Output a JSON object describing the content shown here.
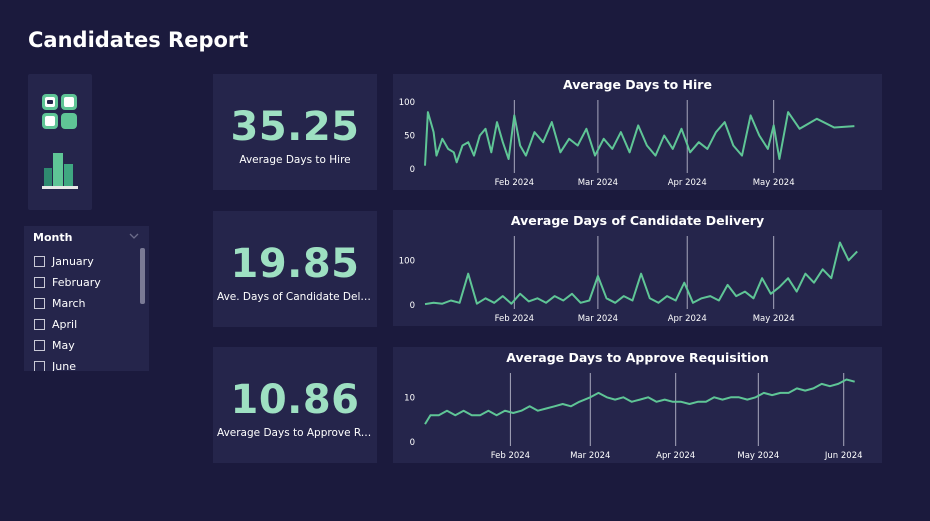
{
  "page": {
    "title": "Candidates Report"
  },
  "nav": {
    "icons": [
      "grid-icon",
      "bar-chart-icon"
    ]
  },
  "slicer": {
    "header": "Month",
    "items": [
      "January",
      "February",
      "March",
      "April",
      "May",
      "June"
    ]
  },
  "cards": [
    {
      "value": "35.25",
      "label": "Average Days to Hire"
    },
    {
      "value": "19.85",
      "label": "Ave. Days of Candidate Delivery"
    },
    {
      "value": "10.86",
      "label": "Average Days to Approve Requisition"
    }
  ],
  "colors": {
    "background": "#1b1a3d",
    "panel": "#25254b",
    "accent": "#5fc596",
    "kpi_text": "#9ee0c2"
  },
  "chart_data": [
    {
      "type": "line",
      "title": "Average Days to Hire",
      "x_range": [
        "2024-01-01",
        "2024-06-01"
      ],
      "ylim": [
        0,
        100
      ],
      "yticks": [
        0,
        50,
        100
      ],
      "xticks": [
        "Feb 2024",
        "Mar 2024",
        "Apr 2024",
        "May 2024"
      ],
      "x": [
        "2024-01-01",
        "2024-01-02",
        "2024-01-04",
        "2024-01-05",
        "2024-01-07",
        "2024-01-09",
        "2024-01-11",
        "2024-01-12",
        "2024-01-14",
        "2024-01-16",
        "2024-01-18",
        "2024-01-20",
        "2024-01-22",
        "2024-01-24",
        "2024-01-26",
        "2024-01-28",
        "2024-01-30",
        "2024-02-01",
        "2024-02-03",
        "2024-02-05",
        "2024-02-08",
        "2024-02-11",
        "2024-02-14",
        "2024-02-17",
        "2024-02-20",
        "2024-02-23",
        "2024-02-26",
        "2024-02-29",
        "2024-03-03",
        "2024-03-06",
        "2024-03-09",
        "2024-03-12",
        "2024-03-15",
        "2024-03-18",
        "2024-03-21",
        "2024-03-24",
        "2024-03-27",
        "2024-03-30",
        "2024-04-02",
        "2024-04-05",
        "2024-04-08",
        "2024-04-11",
        "2024-04-14",
        "2024-04-17",
        "2024-04-20",
        "2024-04-23",
        "2024-04-26",
        "2024-04-29",
        "2024-05-01",
        "2024-05-03",
        "2024-05-06",
        "2024-05-10",
        "2024-05-16",
        "2024-05-22",
        "2024-05-29"
      ],
      "series": [
        {
          "values": [
            5,
            85,
            55,
            20,
            45,
            30,
            25,
            10,
            35,
            40,
            20,
            50,
            60,
            25,
            70,
            40,
            15,
            80,
            35,
            20,
            55,
            40,
            70,
            25,
            45,
            35,
            60,
            20,
            45,
            30,
            55,
            25,
            65,
            35,
            20,
            50,
            30,
            60,
            25,
            40,
            30,
            55,
            70,
            35,
            20,
            80,
            50,
            30,
            65,
            15,
            85,
            60,
            75,
            62,
            64
          ]
        }
      ]
    },
    {
      "type": "line",
      "title": "Average Days of Candidate Delivery",
      "x_range": [
        "2024-01-01",
        "2024-06-01"
      ],
      "ylim": [
        0,
        150
      ],
      "yticks": [
        0,
        100
      ],
      "xticks": [
        "Feb 2024",
        "Mar 2024",
        "Apr 2024",
        "May 2024"
      ],
      "x": [
        "2024-01-01",
        "2024-01-04",
        "2024-01-07",
        "2024-01-10",
        "2024-01-13",
        "2024-01-16",
        "2024-01-19",
        "2024-01-22",
        "2024-01-25",
        "2024-01-28",
        "2024-01-31",
        "2024-02-03",
        "2024-02-06",
        "2024-02-09",
        "2024-02-12",
        "2024-02-15",
        "2024-02-18",
        "2024-02-21",
        "2024-02-24",
        "2024-02-27",
        "2024-03-01",
        "2024-03-04",
        "2024-03-07",
        "2024-03-10",
        "2024-03-13",
        "2024-03-16",
        "2024-03-19",
        "2024-03-22",
        "2024-03-25",
        "2024-03-28",
        "2024-03-31",
        "2024-04-03",
        "2024-04-06",
        "2024-04-09",
        "2024-04-12",
        "2024-04-15",
        "2024-04-18",
        "2024-04-21",
        "2024-04-24",
        "2024-04-27",
        "2024-04-30",
        "2024-05-03",
        "2024-05-06",
        "2024-05-09",
        "2024-05-12",
        "2024-05-15",
        "2024-05-18",
        "2024-05-21",
        "2024-05-24",
        "2024-05-27",
        "2024-05-30"
      ],
      "series": [
        {
          "values": [
            2,
            5,
            3,
            10,
            5,
            70,
            3,
            15,
            5,
            20,
            3,
            25,
            8,
            15,
            5,
            20,
            10,
            25,
            5,
            10,
            65,
            15,
            5,
            20,
            10,
            70,
            15,
            5,
            20,
            10,
            50,
            5,
            15,
            20,
            10,
            45,
            20,
            30,
            15,
            60,
            25,
            40,
            60,
            30,
            70,
            50,
            80,
            60,
            140,
            100,
            120
          ]
        }
      ]
    },
    {
      "type": "line",
      "title": "Average Days to Approve Requisition",
      "x_range": [
        "2024-01-01",
        "2024-06-08"
      ],
      "ylim": [
        0,
        15
      ],
      "yticks": [
        0,
        10
      ],
      "xticks": [
        "Feb 2024",
        "Mar 2024",
        "Apr 2024",
        "May 2024",
        "Jun 2024"
      ],
      "x": [
        "2024-01-01",
        "2024-01-03",
        "2024-01-06",
        "2024-01-09",
        "2024-01-12",
        "2024-01-15",
        "2024-01-18",
        "2024-01-21",
        "2024-01-24",
        "2024-01-27",
        "2024-01-30",
        "2024-02-02",
        "2024-02-05",
        "2024-02-08",
        "2024-02-11",
        "2024-02-14",
        "2024-02-17",
        "2024-02-20",
        "2024-02-23",
        "2024-02-26",
        "2024-03-01",
        "2024-03-04",
        "2024-03-07",
        "2024-03-10",
        "2024-03-13",
        "2024-03-16",
        "2024-03-19",
        "2024-03-22",
        "2024-03-25",
        "2024-03-28",
        "2024-03-31",
        "2024-04-03",
        "2024-04-06",
        "2024-04-09",
        "2024-04-12",
        "2024-04-15",
        "2024-04-18",
        "2024-04-21",
        "2024-04-24",
        "2024-04-27",
        "2024-04-30",
        "2024-05-03",
        "2024-05-06",
        "2024-05-09",
        "2024-05-12",
        "2024-05-15",
        "2024-05-18",
        "2024-05-21",
        "2024-05-24",
        "2024-05-27",
        "2024-05-30",
        "2024-06-02",
        "2024-06-05"
      ],
      "series": [
        {
          "values": [
            4,
            6,
            6,
            7,
            6,
            7,
            6,
            6,
            7,
            6,
            7,
            6.5,
            7,
            8,
            7,
            7.5,
            8,
            8.5,
            8,
            9,
            10,
            11,
            10,
            9.5,
            10,
            9,
            9.5,
            10,
            9,
            9.5,
            9,
            9,
            8.5,
            9,
            9,
            10,
            9.5,
            10,
            10,
            9.5,
            10,
            11,
            10.5,
            11,
            11,
            12,
            11.5,
            12,
            13,
            12.5,
            13,
            14,
            13.5
          ]
        }
      ]
    }
  ]
}
